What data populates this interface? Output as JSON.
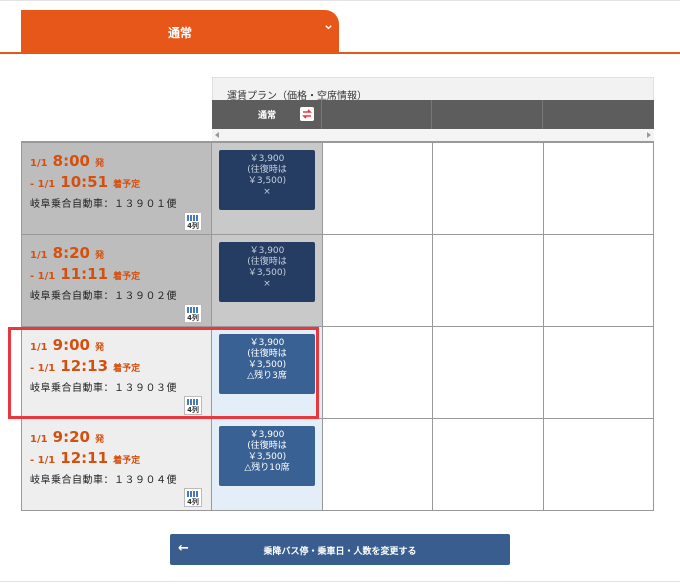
{
  "tab": {
    "label": "通常",
    "chevron_icon": "chevron-down-icon"
  },
  "plan": {
    "title": "運賃プラン（価格・空席情報）",
    "column_label": "通常",
    "swap_icon": "swap-icon"
  },
  "rows": [
    {
      "dep_date": "1/1",
      "dep_time": "8:00",
      "dep_suffix": "発",
      "arr_date": "- 1/1",
      "arr_time": "10:51",
      "arr_suffix": "着予定",
      "company": "岐阜乗合自動車：１３９０１便",
      "seat_icon_label": "4列",
      "fare_price": "￥3,900",
      "fare_rt1": "(往復時は",
      "fare_rt2": "￥3,500)",
      "fare_status": "×"
    },
    {
      "dep_date": "1/1",
      "dep_time": "8:20",
      "dep_suffix": "発",
      "arr_date": "- 1/1",
      "arr_time": "11:11",
      "arr_suffix": "着予定",
      "company": "岐阜乗合自動車：１３９０２便",
      "seat_icon_label": "4列",
      "fare_price": "￥3,900",
      "fare_rt1": "(往復時は",
      "fare_rt2": "￥3,500)",
      "fare_status": "×"
    },
    {
      "dep_date": "1/1",
      "dep_time": "9:00",
      "dep_suffix": "発",
      "arr_date": "- 1/1",
      "arr_time": "12:13",
      "arr_suffix": "着予定",
      "company": "岐阜乗合自動車：１３９０３便",
      "seat_icon_label": "4列",
      "fare_price": "￥3,900",
      "fare_rt1": "(往復時は",
      "fare_rt2": "￥3,500)",
      "fare_status": "△残り3席"
    },
    {
      "dep_date": "1/1",
      "dep_time": "9:20",
      "dep_suffix": "発",
      "arr_date": "- 1/1",
      "arr_time": "12:11",
      "arr_suffix": "着予定",
      "company": "岐阜乗合自動車：１３９０４便",
      "seat_icon_label": "4列",
      "fare_price": "￥3,900",
      "fare_rt1": "(往復時は",
      "fare_rt2": "￥3,500)",
      "fare_status": "△残り10席"
    }
  ],
  "change_button": {
    "arrow": "←",
    "label": "乗降バス停・乗車日・人数を変更する"
  },
  "colors": {
    "accent": "#e8571a",
    "highlight": "#e8383d",
    "fare_active": "#3a6194",
    "fare_soldout": "#253d63"
  }
}
